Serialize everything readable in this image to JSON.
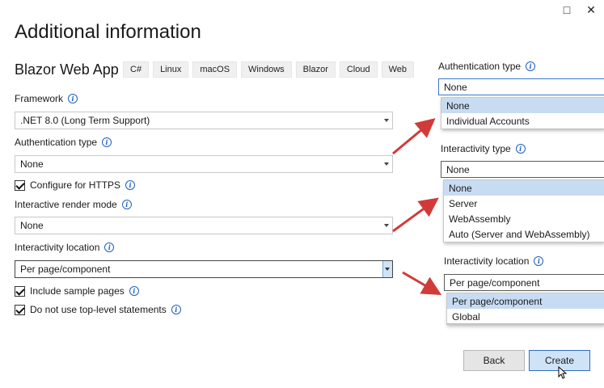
{
  "window": {
    "maximize_icon": "□",
    "close_icon": "✕"
  },
  "page_title": "Additional information",
  "app": {
    "name": "Blazor Web App",
    "tags": [
      "C#",
      "Linux",
      "macOS",
      "Windows",
      "Blazor",
      "Cloud",
      "Web"
    ]
  },
  "form": {
    "framework": {
      "label": "Framework",
      "value": ".NET 8.0 (Long Term Support)"
    },
    "auth": {
      "label": "Authentication type",
      "value": "None"
    },
    "https": {
      "label": "Configure for HTTPS",
      "checked": true
    },
    "render_mode": {
      "label": "Interactive render mode",
      "value": "None"
    },
    "location": {
      "label": "Interactivity location",
      "value": "Per page/component"
    },
    "sample_pages": {
      "label": "Include sample pages",
      "checked": true
    },
    "top_level": {
      "label": "Do not use top-level statements",
      "checked": true
    }
  },
  "callouts": {
    "auth": {
      "label": "Authentication type",
      "value": "None",
      "options": [
        "None",
        "Individual Accounts"
      ]
    },
    "interactivity": {
      "label": "Interactivity type",
      "value": "None",
      "options": [
        "None",
        "Server",
        "WebAssembly",
        "Auto (Server and WebAssembly)"
      ]
    },
    "location": {
      "label": "Interactivity location",
      "value": "Per page/component",
      "options": [
        "Per page/component",
        "Global"
      ]
    }
  },
  "buttons": {
    "back": "Back",
    "create": "Create"
  },
  "colors": {
    "accent": "#2f6cc2",
    "selected": "#c7dcf3",
    "arrow": "#d23a3a"
  }
}
